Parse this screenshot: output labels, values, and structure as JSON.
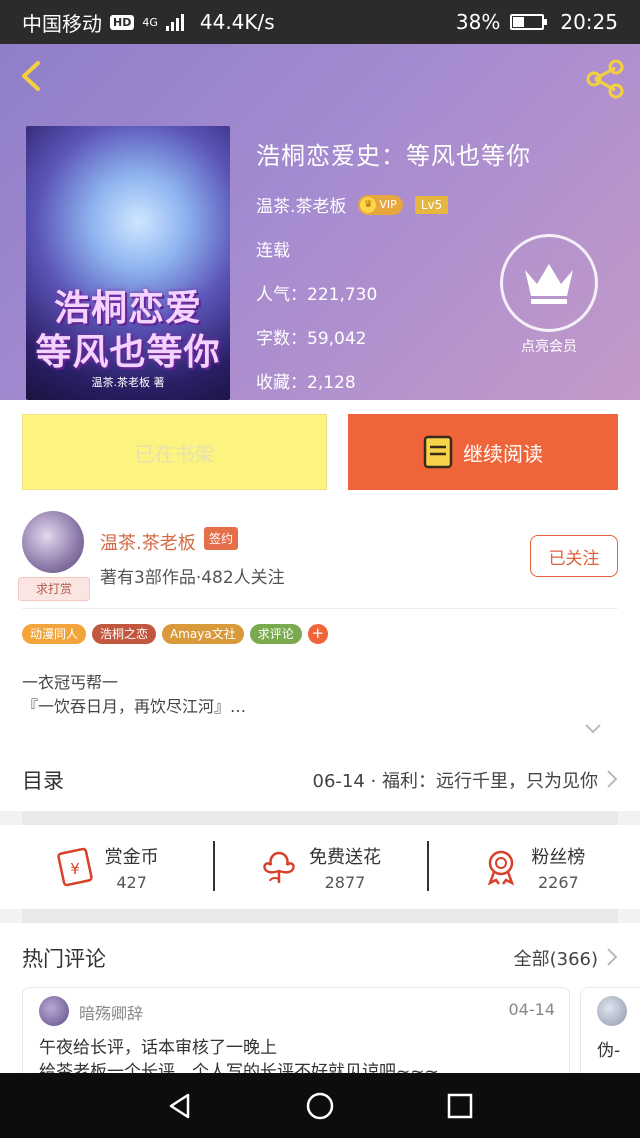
{
  "status_bar": {
    "carrier": "中国移动",
    "hd": "HD",
    "network": "4G",
    "speed": "44.4K/s",
    "battery": "38%",
    "battery_level": 0.38,
    "time": "20:25"
  },
  "header": {
    "book_title": "浩桐恋爱史：等风也等你",
    "author": "温茶.茶老板",
    "vip_label": "VIP",
    "level": "Lv5",
    "status": "连载",
    "popularity": "人气：221,730",
    "word_count": "字数：59,042",
    "favorites": "收藏：2,128",
    "member_label": "点亮会员",
    "cover": {
      "title": "浩桐恋爱 等风也等你",
      "author": "温茶.茶老板 著"
    }
  },
  "actions": {
    "shelf_label": "已在书架",
    "read_label": "继续阅读"
  },
  "author_card": {
    "name": "温茶.茶老板",
    "sign_badge": "签约",
    "tip_badge": "求打赏",
    "stats": "著有3部作品·482人关注",
    "follow_label": "已关注",
    "tags": [
      {
        "label": "动漫同人",
        "color": "#f3a43a"
      },
      {
        "label": "浩桐之恋",
        "color": "#c1573f"
      },
      {
        "label": "Amaya文社",
        "color": "#d99a3c"
      },
      {
        "label": "求评论",
        "color": "#7aa94e"
      }
    ],
    "tag_more": "+",
    "intro_line1": "一衣冠丐帮一",
    "intro_line2": "『一饮吞日月，再饮尽江河』…"
  },
  "catalog": {
    "title": "目录",
    "latest": "06-14 · 福利：远行千里，只为见你"
  },
  "support": [
    {
      "icon": "red-envelope-icon",
      "label": "赏金币",
      "count": "427"
    },
    {
      "icon": "flower-icon",
      "label": "免费送花",
      "count": "2877"
    },
    {
      "icon": "medal-icon",
      "label": "粉丝榜",
      "count": "2267"
    }
  ],
  "comments": {
    "title": "热门评论",
    "all_label": "全部(366)",
    "items": [
      {
        "user": "暗殇卿辞",
        "date": "04-14",
        "line1": "午夜给长评，话本审核了一晚上",
        "line2": "给茶老板一个长评，个人写的长评不好就见谅吧~~~"
      },
      {
        "text": "伪-"
      }
    ]
  },
  "colors": {
    "accent": "#f0643a",
    "shelf": "#fcf47f",
    "header_gradient_start": "#8f7fc8",
    "header_gradient_end": "#c39ac9"
  }
}
